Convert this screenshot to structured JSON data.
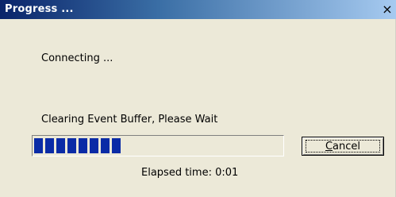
{
  "window": {
    "title": "Progress ...",
    "close_glyph": "×"
  },
  "status": {
    "connecting_text": "Connecting ...",
    "operation_text": "Clearing Event Buffer, Please Wait",
    "elapsed_text": "Elapsed time: 0:01"
  },
  "progress": {
    "filled_segments": 8,
    "approx_fraction": 0.4,
    "color": "#0a2ba6"
  },
  "buttons": {
    "cancel_label": "Cancel",
    "cancel_mnemonic": "C"
  },
  "colors": {
    "title_bar_start": "#0a246a",
    "title_bar_end": "#a6caf0",
    "dialog_bg": "#ece9d8"
  },
  "icons": {
    "close": "close-icon"
  }
}
